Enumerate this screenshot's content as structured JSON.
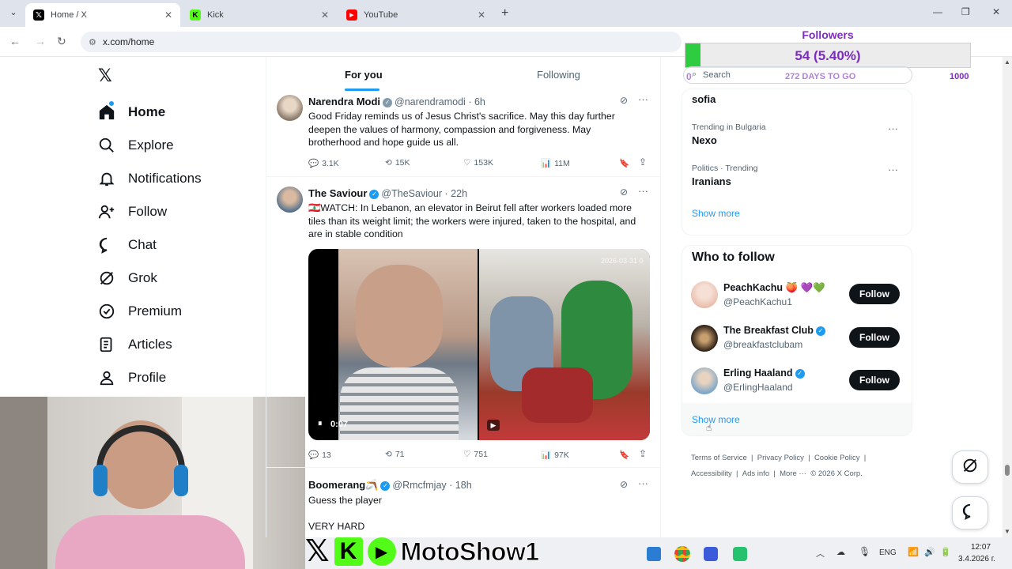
{
  "browser": {
    "tabs": [
      {
        "title": "Home / X",
        "favicon": "x-logo-icon",
        "active": true
      },
      {
        "title": "Kick",
        "favicon": "kick-logo-icon",
        "active": false
      },
      {
        "title": "YouTube",
        "favicon": "youtube-logo-icon",
        "active": false
      }
    ],
    "url": "x.com/home"
  },
  "sidebar": {
    "items": [
      {
        "label": "Home",
        "icon": "home-icon"
      },
      {
        "label": "Explore",
        "icon": "search-icon"
      },
      {
        "label": "Notifications",
        "icon": "bell-icon"
      },
      {
        "label": "Follow",
        "icon": "add-person-icon"
      },
      {
        "label": "Chat",
        "icon": "chat-icon"
      },
      {
        "label": "Grok",
        "icon": "grok-icon"
      },
      {
        "label": "Premium",
        "icon": "premium-icon"
      },
      {
        "label": "Articles",
        "icon": "articles-icon"
      },
      {
        "label": "Profile",
        "icon": "profile-icon"
      }
    ]
  },
  "feed": {
    "tabs": [
      "For you",
      "Following"
    ],
    "posts": [
      {
        "name": "Narendra Modi",
        "handle": "@narendramodi",
        "time": "· 6h",
        "text": "Good Friday reminds us of Jesus Christ's sacrifice. May this day further deepen the values of harmony, compassion and forgiveness. May brotherhood and hope guide us all.",
        "replies": "3.1K",
        "reposts": "15K",
        "likes": "153K",
        "views": "11M"
      },
      {
        "name": "The Saviour",
        "handle": "@TheSaviour",
        "time": "· 22h",
        "text": "🇱🇧WATCH: In Lebanon, an elevator in Beirut fell after workers loaded more tiles than its weight limit; the workers were injured, taken to the hospital, and are in stable condition",
        "video_time": "0:07",
        "video_stamp": "2026-03-31 0",
        "replies": "13",
        "reposts": "71",
        "likes": "751",
        "views": "97K"
      },
      {
        "name": "Boomerang🪃",
        "handle": "@Rmcfmjay",
        "time": "· 18h",
        "text": "Guess the player",
        "text2": "VERY HARD"
      }
    ]
  },
  "overlay": {
    "title": "Followers",
    "value": "54 (5.40%)",
    "progress": 0.054,
    "start": "0",
    "days": "272 DAYS TO GO",
    "goal": "1000"
  },
  "right": {
    "search_placeholder": "Search",
    "trends": [
      {
        "label": "",
        "title": "sofia"
      },
      {
        "label": "Trending in Bulgaria",
        "title": "Nexo"
      },
      {
        "label": "Politics · Trending",
        "title": "Iranians"
      }
    ],
    "show_more": "Show more",
    "wtf_title": "Who to follow",
    "suggestions": [
      {
        "name": "PeachKachu 🍑 💜💚",
        "handle": "@PeachKachu1",
        "button": "Follow"
      },
      {
        "name": "The Breakfast Club",
        "handle": "@breakfastclubam",
        "button": "Follow"
      },
      {
        "name": "Erling Haaland",
        "handle": "@ErlingHaaland",
        "button": "Follow"
      }
    ],
    "show_more2": "Show more",
    "footer": [
      "Terms of Service",
      "|",
      "Privacy Policy",
      "|",
      "Cookie Policy",
      "|",
      "Accessibility",
      "|",
      "Ads info",
      "|",
      "More ···",
      "© 2026 X Corp."
    ]
  },
  "stream": {
    "brand": "MotoShow1"
  },
  "taskbar": {
    "lang": "ENG",
    "time": "12:07",
    "date": "3.4.2026 г."
  },
  "colors": {
    "x_blue": "#1d9bf0",
    "progress_green": "#2ecc40",
    "overlay_purple": "#7b2cbf"
  }
}
